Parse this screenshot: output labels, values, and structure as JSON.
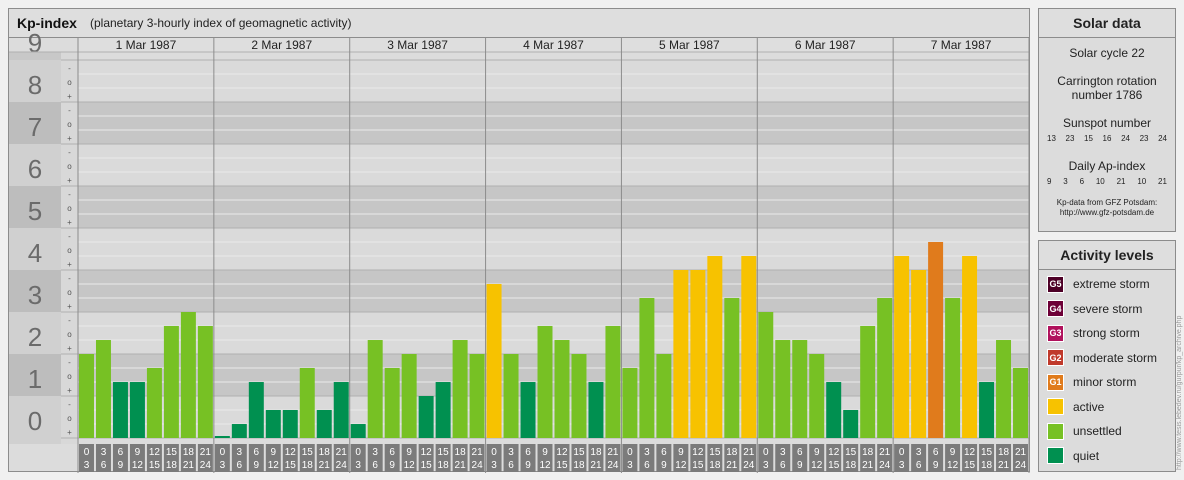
{
  "header": {
    "title": "Kp-index",
    "subtitle": "(planetary 3-hourly index of geomagnetic activity)"
  },
  "solar": {
    "heading": "Solar data",
    "cycle": "Solar cycle 22",
    "rotation_line1": "Carrington rotation",
    "rotation_line2": "number 1786",
    "sunspot_label": "Sunspot number",
    "sunspot_values": [
      "13",
      "23",
      "15",
      "16",
      "24",
      "23",
      "24"
    ],
    "ap_label": "Daily Ap-index",
    "ap_values": [
      "9",
      "3",
      "6",
      "10",
      "21",
      "10",
      "21"
    ],
    "source_line1": "Kp-data from GFZ Potsdam:",
    "source_line2": "http://www.gfz-potsdam.de"
  },
  "levels": {
    "heading": "Activity levels",
    "items": [
      {
        "code": "G5",
        "label": "extreme storm",
        "color": "#4d0026"
      },
      {
        "code": "G4",
        "label": "severe storm",
        "color": "#6d0037"
      },
      {
        "code": "G3",
        "label": "strong storm",
        "color": "#b0115c"
      },
      {
        "code": "G2",
        "label": "moderate storm",
        "color": "#c0392b"
      },
      {
        "code": "G1",
        "label": "minor storm",
        "color": "#e07b1c"
      },
      {
        "code": "",
        "label": "active",
        "color": "#f7c200"
      },
      {
        "code": "",
        "label": "unsettled",
        "color": "#77c124"
      },
      {
        "code": "",
        "label": "quiet",
        "color": "#009050"
      }
    ]
  },
  "credit": "http://www.tesis.lebedev.ru/gurpur/kp_archive.php",
  "chart_data": {
    "type": "bar",
    "title": "Kp-index",
    "subtitle": "(planetary 3-hourly index of geomagnetic activity)",
    "ylim": [
      0,
      9
    ],
    "y_ticks": [
      "0",
      "1",
      "2",
      "3",
      "4",
      "5",
      "6",
      "7",
      "8",
      "9"
    ],
    "minor_ticks": [
      "+",
      "o",
      "-"
    ],
    "days": [
      "1 Mar 1987",
      "2 Mar 1987",
      "3 Mar 1987",
      "4 Mar 1987",
      "5 Mar 1987",
      "6 Mar 1987",
      "7 Mar 1987"
    ],
    "interval_start": [
      "0",
      "3",
      "6",
      "9",
      "12",
      "15",
      "18",
      "21"
    ],
    "interval_end": [
      "3",
      "6",
      "9",
      "12",
      "15",
      "18",
      "21",
      "24"
    ],
    "values": [
      [
        2.0,
        2.333,
        1.333,
        1.333,
        1.667,
        2.667,
        3.0,
        2.667
      ],
      [
        0.0,
        0.333,
        1.333,
        0.667,
        0.667,
        1.667,
        0.667,
        1.333
      ],
      [
        0.333,
        2.333,
        1.667,
        2.0,
        1.0,
        1.333,
        2.333,
        2.0
      ],
      [
        3.667,
        2.0,
        1.333,
        2.667,
        2.333,
        2.0,
        1.333,
        2.667
      ],
      [
        1.667,
        3.333,
        2.0,
        4.0,
        4.0,
        4.333,
        3.333,
        4.333
      ],
      [
        3.0,
        2.333,
        2.333,
        2.0,
        1.333,
        0.667,
        2.667,
        3.333
      ],
      [
        4.333,
        4.0,
        4.667,
        3.333,
        4.333,
        1.333,
        2.333,
        1.667
      ]
    ],
    "categories": [
      "quiet",
      "unsettled",
      "active",
      "minor storm"
    ],
    "colors": {
      "quiet": "#009050",
      "unsettled": "#77c124",
      "active": "#f7c200",
      "minor_storm": "#e07b1c"
    }
  }
}
